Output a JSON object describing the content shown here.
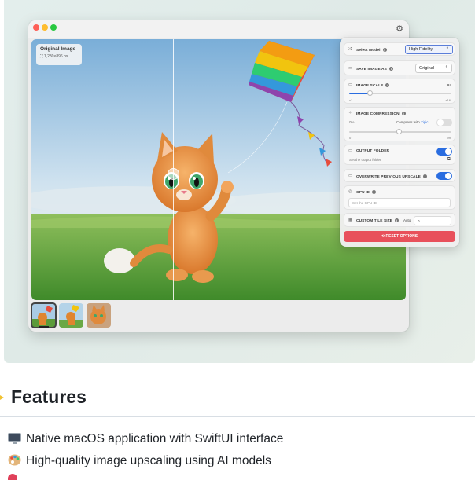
{
  "window": {
    "preview_badge": {
      "title": "Original Image",
      "dimensions": "1,280×896 px"
    }
  },
  "thumbnails": [
    {
      "name": "cat-kite-thumb-1",
      "selected": true
    },
    {
      "name": "cat-kite-thumb-2",
      "selected": false
    },
    {
      "name": "cat-portrait-thumb-3",
      "selected": false
    }
  ],
  "settings": {
    "select_model": {
      "label": "Select Model",
      "value": "High Fidelity"
    },
    "save_image_as": {
      "label": "SAVE IMAGE AS",
      "value": "Original"
    },
    "image_scale": {
      "label": "IMAGE SCALE",
      "value": "X4",
      "min": "x1",
      "max": "x16",
      "level": 0.2
    },
    "image_compression": {
      "label": "IMAGE COMPRESSION",
      "value": "0%",
      "toggle_label": "Compress with",
      "toggle_brand": "Zipic",
      "min": "0",
      "max": "99",
      "enabled": false
    },
    "output_folder": {
      "label": "OUTPUT FOLDER",
      "hint": "Set the output folder",
      "enabled": true
    },
    "overwrite": {
      "label": "OVERWRITE PREVIOUS UPSCALE",
      "enabled": true
    },
    "gpu_id": {
      "label": "GPU ID",
      "placeholder": "Set the GPU ID"
    },
    "tile_size": {
      "label": "CUSTOM TILE SIZE",
      "auto_label": "Auto",
      "value": "0"
    },
    "reset_label": "RESET OPTIONS"
  },
  "features": {
    "title": "Features",
    "items": [
      {
        "label": "Native macOS application with SwiftUI interface"
      },
      {
        "label": "High-quality image upscaling using AI models"
      }
    ]
  },
  "colors": {
    "accent": "#2a6de0",
    "reset": "#e8505b",
    "focus": "#5b7ed9"
  }
}
